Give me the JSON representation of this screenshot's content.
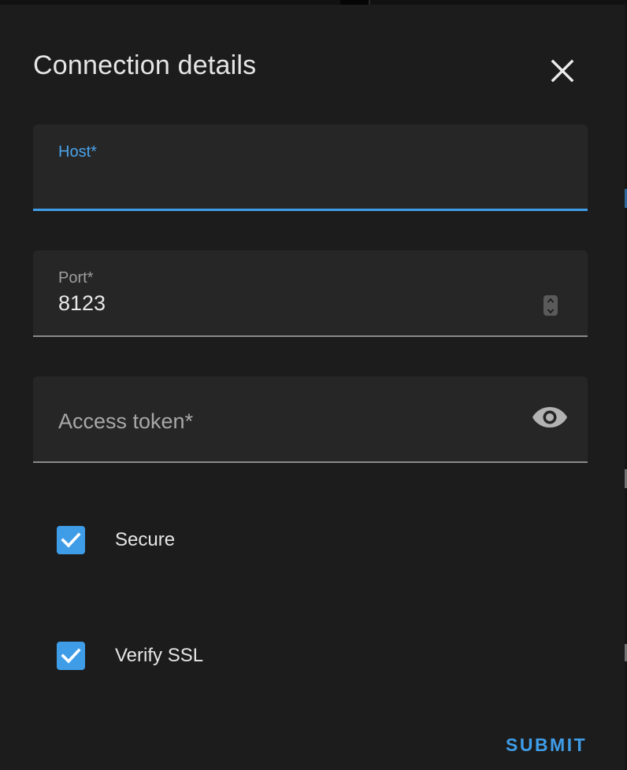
{
  "dialog": {
    "title": "Connection details",
    "close_icon": "close-icon"
  },
  "host": {
    "label": "Host*",
    "value": "",
    "focused": true
  },
  "port": {
    "label": "Port*",
    "value": "8123",
    "spinner_icon": "spinner-arrows-icon"
  },
  "access_token": {
    "label": "Access token*",
    "value": "",
    "toggle_icon": "eye-icon"
  },
  "options": {
    "secure": {
      "label": "Secure",
      "checked": true
    },
    "verify_ssl": {
      "label": "Verify SSL",
      "checked": true
    }
  },
  "actions": {
    "submit_label": "SUBMIT"
  },
  "colors": {
    "accent": "#3f9de8",
    "surface": "#1c1c1c",
    "field_bg": "#262626",
    "text": "#e6e6e6",
    "muted_text": "#9e9e9e"
  }
}
